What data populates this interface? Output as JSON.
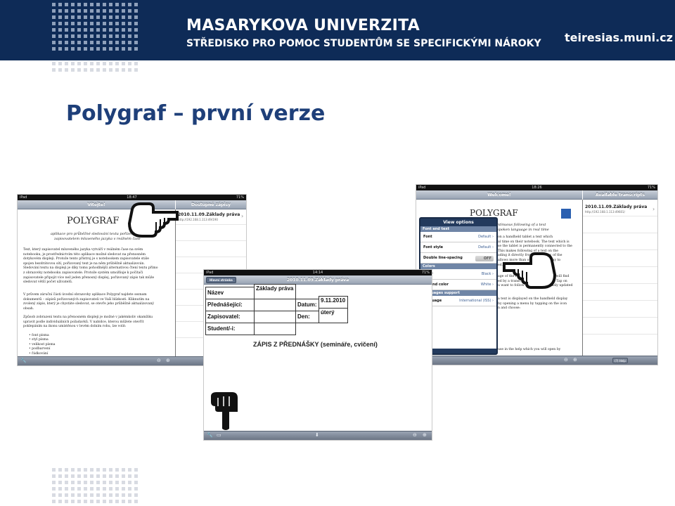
{
  "header": {
    "university": "MASARYKOVA UNIVERZITA",
    "department": "STŘEDISKO PRO POMOC STUDENTŮM SE SPECIFICKÝMI NÁROKY",
    "website": "teiresias.muni.cz"
  },
  "slide": {
    "title": "Polygraf – první verze"
  },
  "screens": [
    {
      "status": {
        "carrier": "iPad",
        "time": "18:47",
        "battery": "71%"
      },
      "left_nav_title": "Vítejte!",
      "right_nav_title": "Dostupné zápisy",
      "doc_title": "POLYGRAF",
      "subtitle_1": "aplikace pro průběžné sledování textu pořízeného",
      "subtitle_2": "zapisovatelem mluveného jazyka v reálném čase",
      "paragraphs": [
        "Text, který zapisovatel mluveného jazyka vytváří v reálném čase na svém",
        "notebooku, je prostřednictvím této aplikace možné sledovat na přenosném",
        "dotykovém displeji. Protože tento přístroj je s notebookem zapisovatele stále",
        "spojen bezdrátovou sítí, pořizovaný text je na něm průběžně aktualizován.",
        "Sledování textu na displeji je díky tomu pohodlnější alternativou čtení textu přímo",
        "z obrazovky notebooku zapisovatele. Protože systém umožňuje k počítači",
        "zapisovatele připojit více než jeden přenosný displej, pořizovaný zápis tak může",
        "sledovat větší počet uživatelů."
      ],
      "paragraphs_2": [
        "V průvem záruční části úvodní obrazovky aplikace Polygraf najdete seznam",
        "dokumentů – zápisů pořizovaných zapisovateli ve Vaší blízkosti. Kliknutím na",
        "zvolený zápis, který je chystáte sledovat, se otevře jeho průběžně aktualizovaný",
        "obsah."
      ],
      "paragraphs_3": [
        "Způsob zobrazení textu na přenosném displeji je možné v jakémkoliv okamžiku",
        "upravit podle individuálních požadavků. V nabídce, kterou můžete otevřít",
        "poklepáním na ikonu umístěnou v levém dolním rohu, lze volit:"
      ],
      "bullets": [
        "font písma",
        "styl písma",
        "velikost písma",
        "podbarvení",
        "řádkování"
      ],
      "transcript_title": "2010.11.09.Základy práva",
      "transcript_sub": "http://192.168.1.113:49/190"
    },
    {
      "status": {
        "carrier": "iPad",
        "time": "14:14",
        "battery": "71%"
      },
      "back_button": "Hlavní stránka",
      "nav_title": "2010.11.09.Základy práva",
      "labels": {
        "subject": "Název předmětu:",
        "lecturer": "Přednášející:",
        "scribe": "Zapisovatel:",
        "student": "Student/-i:",
        "date": "Datum:",
        "day": "Den:"
      },
      "values": {
        "subject": "Základy práva",
        "date": "9.11.2010",
        "day": "úterý"
      },
      "heading": "ZÁPIS Z PŘEDNÁŠKY (semináře, cvičení)"
    },
    {
      "status": {
        "carrier": "iPad",
        "time": "18:26",
        "battery": "71%"
      },
      "left_nav_title": "Welcome!",
      "right_nav_title": "Available transcripts",
      "doc_title": "POLYGRAF",
      "subtitle_1": "ntinuous following of a text",
      "subtitle_2": "spoken language in real time",
      "body_lines": [
        "on a handheld tablet a text which",
        "al time on their notebook. The text which is",
        "se the tablet is permanently connected to the",
        "This makes following of a text on the",
        "ading it directly from the display of the",
        "allows more than one tablet display to",
        "ed."
      ],
      "body_lines_2": [
        "age of the Polygraf application you will find",
        "ed by a transcriber in your vicinity. Tap on",
        "u want to follow and its continuously updated"
      ],
      "body_lines_3": [
        "a text is displayed on the handheld display",
        "by opening a menu by tapping on the icon",
        "n and choose:"
      ],
      "body_lines_4": [
        "use in the help which you will open by"
      ],
      "transcript_title": "2010.11.09.Základy práva",
      "transcript_sub": "http://192.168.1.113:49601/",
      "help_button": "Help",
      "popover": {
        "title": "View options",
        "section_font": "Font and text",
        "font_label": "Font",
        "font_value": "Default",
        "style_label": "Font style",
        "style_value": "Default",
        "spacing_label": "Double line-spacing",
        "spacing_value": "OFF",
        "section_colors": "Colors",
        "color_label": "color",
        "color_value": "Black",
        "bg_label": "ground color",
        "bg_value": "White",
        "section_lang": "languages support",
        "lang_label": "language",
        "lang_value": "International (ISS)"
      }
    }
  ],
  "icons": [
    "wrench-icon",
    "zoom-out-icon",
    "zoom-in-icon",
    "hand-pointer-icon",
    "chat-icon",
    "download-icon"
  ]
}
